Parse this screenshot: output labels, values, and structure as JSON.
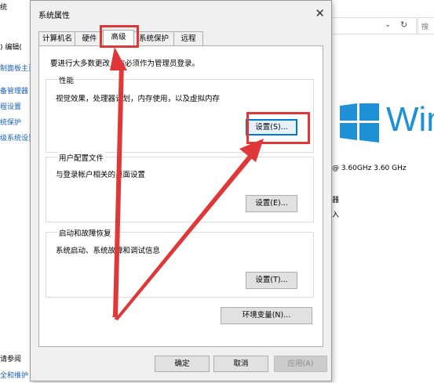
{
  "background": {
    "left_items": [
      "统",
      ")  编辑(",
      "制面板主页",
      "备管理器",
      "程设置",
      "统保护",
      "级系统设置",
      "请参阅",
      "全和维护"
    ],
    "address_chevron": "⌄",
    "refresh_icon": "↻",
    "search_placeholder": "搜",
    "windows_logo_text": "Win",
    "cpu_speed": "@ 3.60GHz   3.60 GHz",
    "text_processor": "器",
    "text_input": "入"
  },
  "dialog": {
    "title": "系统属性",
    "close": "✕",
    "tabs": [
      {
        "label": "计算机名"
      },
      {
        "label": "硬件"
      },
      {
        "label": "高级"
      },
      {
        "label": "系统保护"
      },
      {
        "label": "远程"
      }
    ],
    "admin_note": "要进行大多数更改，你必须作为管理员登录。",
    "performance": {
      "label": "性能",
      "desc": "视觉效果，处理器计划，内存使用，以及虚拟内存",
      "button": "设置(S)..."
    },
    "user_profiles": {
      "label": "用户配置文件",
      "desc": "与登录帐户相关的桌面设置",
      "button": "设置(E)..."
    },
    "startup": {
      "label": "启动和故障恢复",
      "desc": "系统启动、系统故障和调试信息",
      "button": "设置(T)..."
    },
    "env_button": "环境变量(N)...",
    "ok": "确定",
    "cancel": "取消",
    "apply": "应用(A)"
  },
  "colors": {
    "annotation": "#e03838",
    "windows_blue": "#1e90d6",
    "focus_blue": "#0078d7"
  }
}
